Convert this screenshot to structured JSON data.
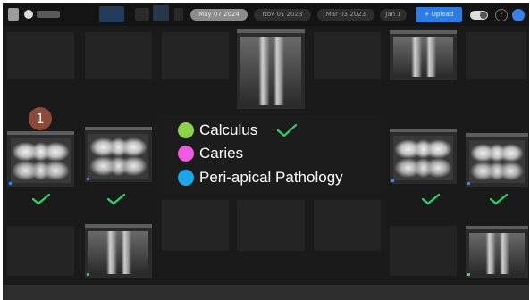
{
  "header": {
    "date_tabs": [
      "May 07 2024",
      "Nov 01 2023",
      "Mar 03 2023",
      "Jan 1"
    ],
    "new_button_label": "+ Upload",
    "help_label": "?"
  },
  "annotation": {
    "badge_number": "1"
  },
  "legend": {
    "items": [
      {
        "label": "Calculus",
        "color": "#8ed24c",
        "checked": true
      },
      {
        "label": "Caries",
        "color": "#ef5be0",
        "checked": false
      },
      {
        "label": "Peri-apical Pathology",
        "color": "#1aa7ec",
        "checked": false
      }
    ]
  },
  "colors": {
    "check": "#2bd46f",
    "accent": "#2f7de1",
    "background": "#1a1a1a",
    "slot": "#242424",
    "badge": "#8b4a3a"
  }
}
